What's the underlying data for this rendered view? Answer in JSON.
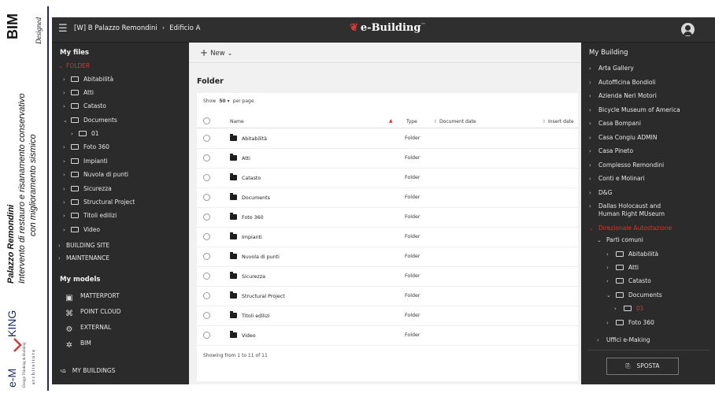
{
  "branding": {
    "bim": "BIM",
    "designed": "Designed",
    "title_line1": "Palazzo Remondini",
    "title_line2": "Intervento di restauro e risanamento conservativo",
    "title_line3": "con miglioramento sismico",
    "logo_text": "e-MAKING engineering architettura"
  },
  "topbar": {
    "breadcrumb": [
      "[W] B Palazzo Remondini",
      "Edificio A"
    ],
    "app_name": "e-Building",
    "app_suffix": "™",
    "accent_color": "#e0312f"
  },
  "left_sidebar": {
    "my_files_label": "My files",
    "tree": [
      {
        "label": "FOLDER",
        "expanded": true,
        "active": true,
        "level": 0
      },
      {
        "label": "Abitabilità",
        "level": 1
      },
      {
        "label": "Atti",
        "level": 1
      },
      {
        "label": "Catasto",
        "level": 1
      },
      {
        "label": "Documents",
        "expanded": true,
        "level": 1
      },
      {
        "label": "01",
        "level": 2
      },
      {
        "label": "Foto 360",
        "level": 1
      },
      {
        "label": "Impianti",
        "level": 1
      },
      {
        "label": "Nuvola di punti",
        "level": 1
      },
      {
        "label": "Sicurezza",
        "level": 1
      },
      {
        "label": "Structural Project",
        "level": 1
      },
      {
        "label": "Titoli edilizi",
        "level": 1
      },
      {
        "label": "Video",
        "level": 1
      },
      {
        "label": "BUILDING SITE",
        "level": 0
      },
      {
        "label": "MAINTENANCE",
        "level": 0
      }
    ],
    "my_models_label": "My models",
    "models": [
      {
        "label": "MATTERPORT",
        "icon": "matterport-icon"
      },
      {
        "label": "POINT CLOUD",
        "icon": "point-cloud-icon"
      },
      {
        "label": "EXTERNAL",
        "icon": "external-icon"
      },
      {
        "label": "BIM",
        "icon": "bim-icon"
      }
    ],
    "my_buildings_label": "MY BUILDINGS"
  },
  "main": {
    "new_label": "New",
    "folder_title": "Folder",
    "show_label": "Show",
    "page_size": "50",
    "per_page_label": "per page",
    "columns": [
      "Name",
      "Type",
      "Document date",
      "Insert date"
    ],
    "rows": [
      {
        "name": "Abitabilità",
        "type": "Folder"
      },
      {
        "name": "Atti",
        "type": "Folder"
      },
      {
        "name": "Catasto",
        "type": "Folder"
      },
      {
        "name": "Documents",
        "type": "Folder"
      },
      {
        "name": "Foto 360",
        "type": "Folder"
      },
      {
        "name": "Impianti",
        "type": "Folder"
      },
      {
        "name": "Nuvola di punti",
        "type": "Folder"
      },
      {
        "name": "Sicurezza",
        "type": "Folder"
      },
      {
        "name": "Structural Project",
        "type": "Folder"
      },
      {
        "name": "Titoli edilizi",
        "type": "Folder"
      },
      {
        "name": "Video",
        "type": "Folder"
      }
    ],
    "showing_text": "Showing from 1 to 11 of 11"
  },
  "right_sidebar": {
    "title": "My Building",
    "buildings": [
      {
        "label": "Arta Gallery"
      },
      {
        "label": "Autofficina Bondioli"
      },
      {
        "label": "Azienda Neri Motori"
      },
      {
        "label": "Bicycle Museum of America"
      },
      {
        "label": "Casa Bompani"
      },
      {
        "label": "Casa Congiu ADMIN"
      },
      {
        "label": "Casa Pineto"
      },
      {
        "label": "Complesso Remondini"
      },
      {
        "label": "Conti e Molinari"
      },
      {
        "label": "D&G"
      },
      {
        "label": "Dallas Holocaust and"
      },
      {
        "label": "Human Right MUseum"
      },
      {
        "label": "Direzionale Autostazione"
      },
      {
        "label": "Parti comuni"
      },
      {
        "label": "Abitabilità"
      },
      {
        "label": "Atti"
      },
      {
        "label": "Catasto"
      },
      {
        "label": "Documents"
      },
      {
        "label": "01"
      },
      {
        "label": "Foto 360"
      },
      {
        "label": "Uffici e-Making"
      }
    ],
    "move_label": "SPOSTA"
  }
}
